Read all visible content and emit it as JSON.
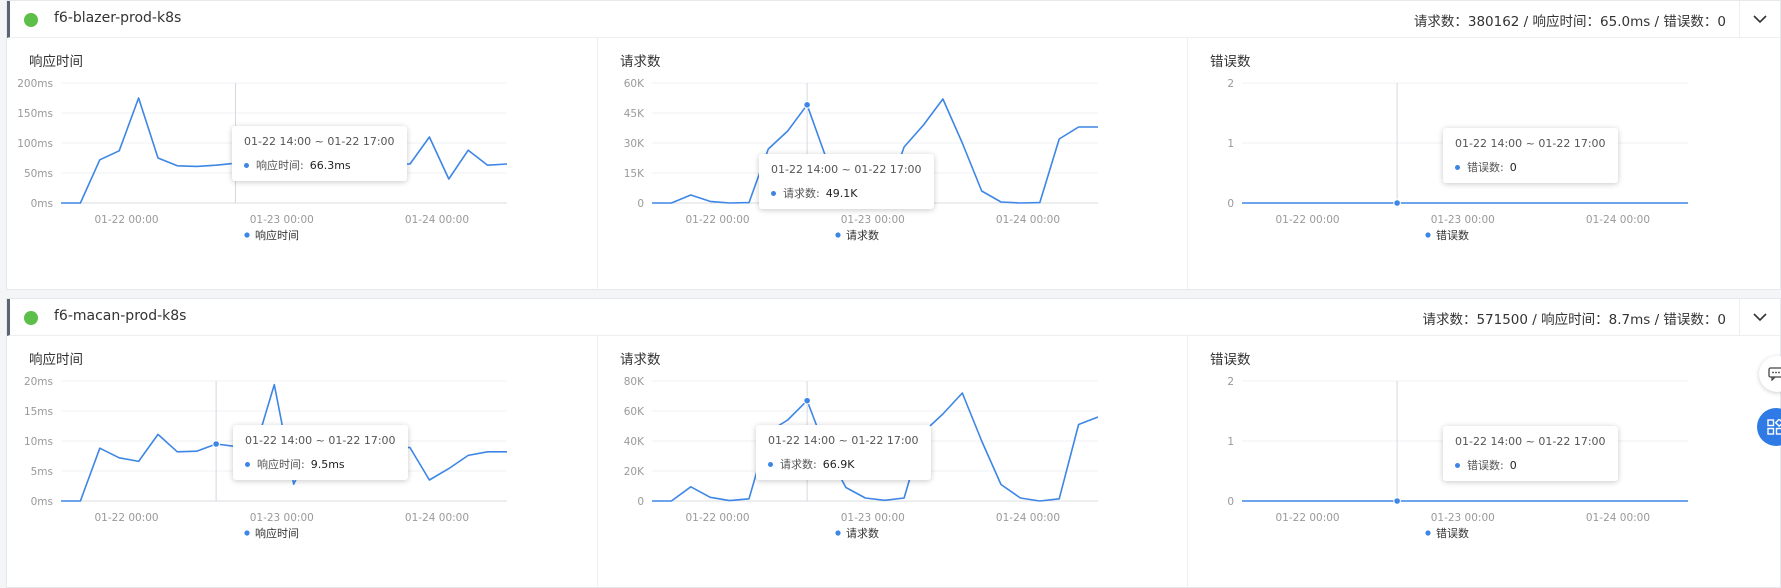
{
  "services": [
    {
      "name": "f6-blazer-prod-k8s",
      "summary": "请求数：380162 / 响应时间：65.0ms / 错误数：0",
      "panels": [
        {
          "title": "响应时间",
          "legend": "响应时间",
          "tooltip": {
            "range": "01-22 14:00 ~ 01-22 17:00",
            "label": "响应时间:",
            "value": "66.3ms"
          },
          "chart_data": {
            "type": "line",
            "ylim": [
              0,
              200
            ],
            "yticks": [
              "0ms",
              "50ms",
              "100ms",
              "150ms",
              "200ms"
            ],
            "xticks": [
              "01-22 00:00",
              "01-23 00:00",
              "01-24 00:00"
            ],
            "x_points": 24,
            "values": [
              0,
              0,
              72,
              87,
              175,
              75,
              62,
              61,
              63,
              66.3,
              66,
              65,
              66,
              67,
              66,
              68,
              67,
              66,
              65,
              110,
              40,
              88,
              63,
              65
            ],
            "highlight_index": 9
          }
        },
        {
          "title": "请求数",
          "legend": "请求数",
          "tooltip": {
            "range": "01-22 14:00 ~ 01-22 17:00",
            "label": "请求数:",
            "value": "49.1K"
          },
          "chart_data": {
            "type": "line",
            "ylim": [
              0,
              60000
            ],
            "yticks": [
              "0",
              "15K",
              "30K",
              "45K",
              "60K"
            ],
            "xticks": [
              "01-22 00:00",
              "01-23 00:00",
              "01-24 00:00"
            ],
            "x_points": 24,
            "values": [
              0,
              0,
              4000,
              800,
              0,
              200,
              27000,
              36000,
              49100,
              22000,
              4000,
              600,
              300,
              28000,
              39000,
              52000,
              30000,
              6000,
              500,
              0,
              200,
              32000,
              38000,
              38000
            ],
            "highlight_index": 8
          }
        },
        {
          "title": "错误数",
          "legend": "错误数",
          "tooltip": {
            "range": "01-22 14:00 ~ 01-22 17:00",
            "label": "错误数:",
            "value": "0"
          },
          "chart_data": {
            "type": "line",
            "ylim": [
              0,
              2
            ],
            "yticks": [
              "0",
              "1",
              "2"
            ],
            "xticks": [
              "01-22 00:00",
              "01-23 00:00",
              "01-24 00:00"
            ],
            "x_points": 24,
            "values": [
              0,
              0,
              0,
              0,
              0,
              0,
              0,
              0,
              0,
              0,
              0,
              0,
              0,
              0,
              0,
              0,
              0,
              0,
              0,
              0,
              0,
              0,
              0,
              0
            ],
            "highlight_index": 8
          }
        }
      ]
    },
    {
      "name": "f6-macan-prod-k8s",
      "summary": "请求数：571500 / 响应时间：8.7ms / 错误数：0",
      "panels": [
        {
          "title": "响应时间",
          "legend": "响应时间",
          "tooltip": {
            "range": "01-22 14:00 ~ 01-22 17:00",
            "label": "响应时间:",
            "value": "9.5ms"
          },
          "chart_data": {
            "type": "line",
            "ylim": [
              0,
              20
            ],
            "yticks": [
              "0ms",
              "5ms",
              "10ms",
              "15ms",
              "20ms"
            ],
            "xticks": [
              "01-22 00:00",
              "01-23 00:00",
              "01-24 00:00"
            ],
            "x_points": 24,
            "values": [
              0,
              0,
              8.8,
              7.2,
              6.6,
              11.1,
              8.2,
              8.3,
              9.5,
              9.1,
              8.6,
              19.4,
              2.8,
              9.6,
              9.8,
              9.7,
              9.3,
              9.1,
              8.9,
              3.5,
              5.4,
              7.6,
              8.2,
              8.2
            ],
            "highlight_index": 8
          }
        },
        {
          "title": "请求数",
          "legend": "请求数",
          "tooltip": {
            "range": "01-22 14:00 ~ 01-22 17:00",
            "label": "请求数:",
            "value": "66.9K"
          },
          "chart_data": {
            "type": "line",
            "ylim": [
              0,
              80000
            ],
            "yticks": [
              "0",
              "20K",
              "40K",
              "60K",
              "80K"
            ],
            "xticks": [
              "01-22 00:00",
              "01-23 00:00",
              "01-24 00:00"
            ],
            "x_points": 24,
            "values": [
              0,
              0,
              9500,
              2500,
              300,
              1500,
              46000,
              54000,
              66900,
              33000,
              9000,
              2000,
              500,
              2000,
              46000,
              58000,
              72000,
              40000,
              11000,
              2000,
              0,
              1500,
              51000,
              56000
            ],
            "highlight_index": 8
          }
        },
        {
          "title": "错误数",
          "legend": "错误数",
          "tooltip": {
            "range": "01-22 14:00 ~ 01-22 17:00",
            "label": "错误数:",
            "value": "0"
          },
          "chart_data": {
            "type": "line",
            "ylim": [
              0,
              2
            ],
            "yticks": [
              "0",
              "1",
              "2"
            ],
            "xticks": [
              "01-22 00:00",
              "01-23 00:00",
              "01-24 00:00"
            ],
            "x_points": 24,
            "values": [
              0,
              0,
              0,
              0,
              0,
              0,
              0,
              0,
              0,
              0,
              0,
              0,
              0,
              0,
              0,
              0,
              0,
              0,
              0,
              0,
              0,
              0,
              0,
              0
            ],
            "highlight_index": 8
          }
        }
      ]
    }
  ],
  "colors": {
    "line": "#3e86e6",
    "status_ok": "#5bbf4a",
    "grid": "#eef0f3",
    "axis": "#999999"
  },
  "side_buttons": [
    "chat-icon",
    "apps-icon"
  ]
}
